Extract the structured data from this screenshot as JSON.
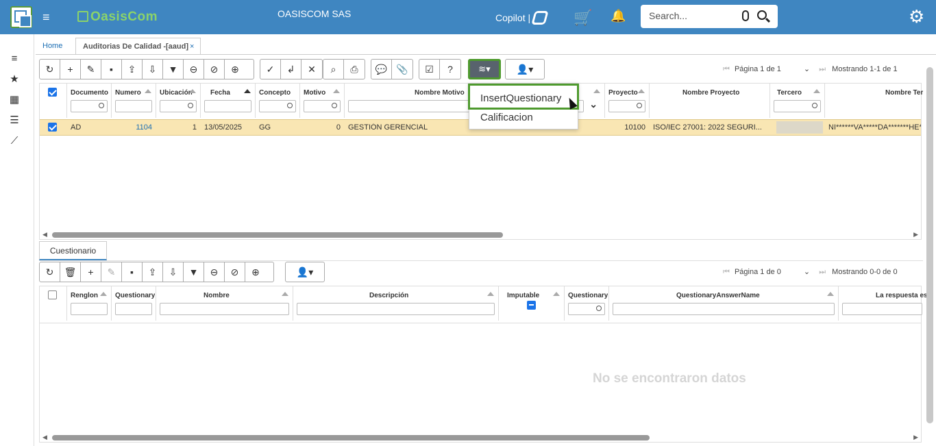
{
  "header": {
    "brand": "OasisCom",
    "company": "OASISCOM SAS",
    "copilot_label": "Copilot |",
    "search_placeholder": "Search...",
    "icons": [
      "app-logo-icon",
      "hamburger-icon",
      "cart-icon",
      "bell-icon",
      "mic-icon",
      "search-icon",
      "gear-icon"
    ]
  },
  "sidebar": {
    "icons": [
      "menu-icon",
      "star-icon",
      "calendar-icon",
      "list-icon",
      "chart-icon"
    ]
  },
  "tabs": {
    "home": "Home",
    "active": "Auditorias De Calidad -[aaud]",
    "close": "×"
  },
  "main_grid": {
    "pager": {
      "page_text": "Página 1 de 1",
      "showing": "Mostrando 1-1 de 1"
    },
    "columns": [
      "Documento",
      "Numero",
      "Ubicación",
      "Fecha",
      "Concepto",
      "Motivo",
      "Nombre Motivo",
      "Proyecto",
      "Nombre Proyecto",
      "Tercero",
      "Nombre Ter"
    ],
    "row": {
      "documento": "AD",
      "numero": "1104",
      "ubicacion": "1",
      "fecha": "13/05/2025",
      "concepto": "GG",
      "motivo": "0",
      "nombre_motivo": "GESTIÓN GERENCIAL",
      "proyecto": "10100",
      "nombre_proyecto": "ISO/IEC 27001: 2022 SEGURI...",
      "tercero": "",
      "nombre_tercero": "NI******VA*****DA*******HE*"
    }
  },
  "dropdown": {
    "item1": "InsertQuestionary",
    "item2": "Calificacion"
  },
  "detail": {
    "tab": "Cuestionario",
    "pager": {
      "page_text": "Página 1 de 0",
      "showing": "Mostrando 0-0 de 0"
    },
    "columns": [
      "Renglon",
      "Questionary",
      "Nombre",
      "Descripción",
      "Imputable",
      "Questionary",
      "QuestionaryAnswerName",
      "La respuesta es"
    ],
    "empty": "No se encontraron datos"
  },
  "colors": {
    "header_bg": "#3f86c1",
    "selected_row": "#f9e6b3",
    "highlight": "#4e9a2e"
  }
}
